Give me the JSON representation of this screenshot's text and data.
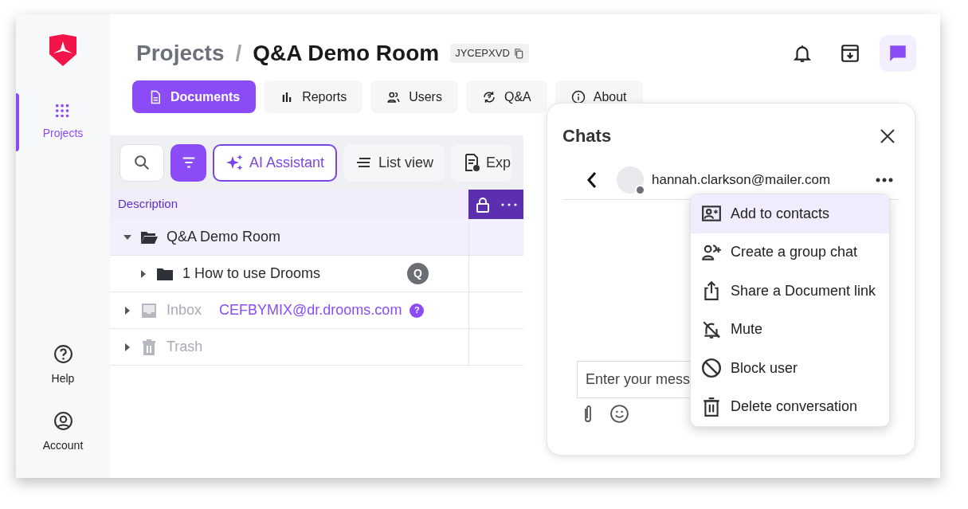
{
  "sidebar": {
    "items": [
      {
        "label": "Projects",
        "kind": "grid",
        "selected": true
      }
    ],
    "footer_items": [
      {
        "label": "Help",
        "kind": "help"
      },
      {
        "label": "Account",
        "kind": "account"
      }
    ]
  },
  "header": {
    "parent": "Projects",
    "separator": "/",
    "current": "Q&A Demo Room",
    "code": "JYCEPXVD"
  },
  "header_actions": [
    {
      "kind": "bell",
      "selected": false
    },
    {
      "kind": "archive",
      "selected": false
    },
    {
      "kind": "chat",
      "selected": true
    }
  ],
  "tabs": [
    {
      "label": "Documents",
      "kind": "document",
      "selected": true
    },
    {
      "label": "Reports",
      "kind": "chart",
      "selected": false
    },
    {
      "label": "Users",
      "kind": "users",
      "selected": false
    },
    {
      "label": "Q&A",
      "kind": "qa",
      "selected": false
    },
    {
      "label": "About",
      "kind": "info",
      "selected": false
    }
  ],
  "toolbar": [
    {
      "kind": "search",
      "selected": false
    },
    {
      "kind": "filter",
      "selected": true
    },
    {
      "kind": "ai",
      "label": "AI Assistant"
    },
    {
      "kind": "list",
      "label": "List view"
    },
    {
      "kind": "export",
      "label": "Exp"
    }
  ],
  "table": {
    "columns": [
      "Description"
    ],
    "rows": [
      {
        "label": "Q&A Demo Room",
        "kind": "folder",
        "expanded": true,
        "selected": true,
        "disabled": false,
        "children": [
          {
            "label": "1 How to use Drooms",
            "kind": "folder",
            "expanded": false,
            "selected": false,
            "disabled": false,
            "badge": "Q"
          }
        ]
      },
      {
        "label": "Inbox",
        "kind": "inbox",
        "expanded": false,
        "selected": false,
        "disabled": true,
        "email": "CEFBYMIX@dr.drooms.com",
        "help": "?"
      },
      {
        "label": "Trash",
        "kind": "trash",
        "expanded": false,
        "selected": false,
        "disabled": true
      }
    ]
  },
  "chat": {
    "title": "Chats",
    "contact": "hannah.clarkson@mailer.com",
    "online": false,
    "composer": {
      "placeholder": "Enter your mess"
    },
    "menu": [
      {
        "label": "Add to contacts",
        "kind": "contact",
        "selected": true
      },
      {
        "label": "Create a group chat",
        "kind": "group",
        "selected": false
      },
      {
        "label": "Share a Document link",
        "kind": "share",
        "selected": false
      },
      {
        "label": "Mute",
        "kind": "mute",
        "selected": false
      },
      {
        "label": "Block user",
        "kind": "block",
        "selected": false
      },
      {
        "label": "Delete conversation",
        "kind": "delete",
        "selected": false
      }
    ]
  }
}
